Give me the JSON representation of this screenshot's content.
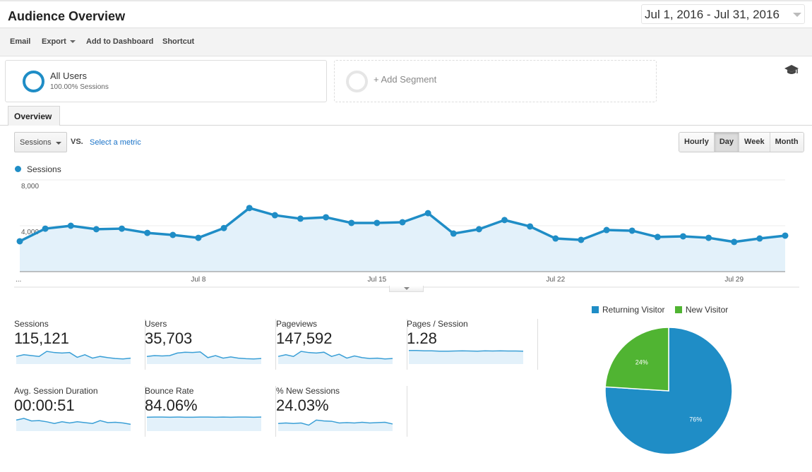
{
  "header": {
    "title": "Audience Overview",
    "date_range": "Jul 1, 2016 - Jul 31, 2016"
  },
  "toolbar": {
    "items": [
      "Email",
      "Export",
      "Add to Dashboard",
      "Shortcut"
    ],
    "help_icon": "graduation-cap-icon"
  },
  "segments": {
    "active": {
      "name": "All Users",
      "sub": "100.00% Sessions",
      "color": "#1f8dc6"
    },
    "add_label": "+ Add Segment"
  },
  "tabs": {
    "overview": "Overview"
  },
  "controls": {
    "metric_select": "Sessions",
    "vs_label": "VS.",
    "select_metric_link": "Select a metric",
    "granularity": [
      "Hourly",
      "Day",
      "Week",
      "Month"
    ],
    "granularity_selected": "Day"
  },
  "chart_data": [
    {
      "type": "area",
      "title": "",
      "legend": [
        "Sessions"
      ],
      "legend_position": "top-left",
      "color": "#1f8dc6",
      "fill": "#e3f1fa",
      "xlabel": "",
      "ylabel": "",
      "ylim": [
        0,
        8000
      ],
      "yticks": [
        4000,
        8000
      ],
      "ytick_labels": [
        "4,000",
        "8,000"
      ],
      "x": [
        "Jul 1",
        "Jul 2",
        "Jul 3",
        "Jul 4",
        "Jul 5",
        "Jul 6",
        "Jul 7",
        "Jul 8",
        "Jul 9",
        "Jul 10",
        "Jul 11",
        "Jul 12",
        "Jul 13",
        "Jul 14",
        "Jul 15",
        "Jul 16",
        "Jul 17",
        "Jul 18",
        "Jul 19",
        "Jul 20",
        "Jul 21",
        "Jul 22",
        "Jul 23",
        "Jul 24",
        "Jul 25",
        "Jul 26",
        "Jul 27",
        "Jul 28",
        "Jul 29",
        "Jul 30",
        "Jul 31"
      ],
      "xtick_labels": [
        {
          "index": 0,
          "label": "..."
        },
        {
          "index": 7,
          "label": "Jul 8"
        },
        {
          "index": 14,
          "label": "Jul 15"
        },
        {
          "index": 21,
          "label": "Jul 22"
        },
        {
          "index": 28,
          "label": "Jul 29"
        }
      ],
      "series": [
        {
          "name": "Sessions",
          "values": [
            2650,
            3750,
            4000,
            3700,
            3750,
            3380,
            3200,
            2950,
            3800,
            5550,
            4920,
            4620,
            4740,
            4250,
            4250,
            4310,
            5100,
            3320,
            3700,
            4500,
            3940,
            2890,
            2770,
            3630,
            3570,
            3020,
            3080,
            2950,
            2590,
            2890,
            3140
          ]
        }
      ],
      "grid": true
    },
    {
      "type": "pie",
      "title": "",
      "legend": [
        "Returning Visitor",
        "New Visitor"
      ],
      "legend_position": "top",
      "slices": [
        {
          "label": "Returning Visitor",
          "value": 76,
          "display": "76%",
          "color": "#1f8dc6"
        },
        {
          "label": "New Visitor",
          "value": 24,
          "display": "24%",
          "color": "#50b432"
        }
      ]
    }
  ],
  "metrics": [
    {
      "label": "Sessions",
      "value": "115,121",
      "spark": [
        0.45,
        0.55,
        0.5,
        0.45,
        0.75,
        0.68,
        0.65,
        0.68,
        0.4,
        0.55,
        0.35,
        0.45,
        0.38,
        0.33,
        0.3,
        0.35
      ]
    },
    {
      "label": "Users",
      "value": "35,703",
      "spark": [
        0.45,
        0.5,
        0.48,
        0.5,
        0.65,
        0.7,
        0.68,
        0.72,
        0.38,
        0.5,
        0.35,
        0.42,
        0.35,
        0.32,
        0.3,
        0.33
      ]
    },
    {
      "label": "Pageviews",
      "value": "147,592",
      "spark": [
        0.45,
        0.55,
        0.45,
        0.75,
        0.68,
        0.65,
        0.7,
        0.45,
        0.58,
        0.35,
        0.48,
        0.38,
        0.33,
        0.35,
        0.3,
        0.33
      ]
    },
    {
      "label": "Pages / Session",
      "value": "1.28",
      "spark": [
        0.8,
        0.8,
        0.78,
        0.78,
        0.76,
        0.76,
        0.77,
        0.78,
        0.77,
        0.76,
        0.78,
        0.77,
        0.78,
        0.77,
        0.77,
        0.76
      ]
    },
    {
      "label": "Avg. Session Duration",
      "value": "00:00:51",
      "spark": [
        0.65,
        0.75,
        0.6,
        0.62,
        0.55,
        0.45,
        0.55,
        0.48,
        0.55,
        0.5,
        0.45,
        0.62,
        0.5,
        0.52,
        0.48,
        0.4
      ]
    },
    {
      "label": "Bounce Rate",
      "value": "84.06%",
      "spark": [
        0.82,
        0.83,
        0.83,
        0.82,
        0.83,
        0.82,
        0.82,
        0.83,
        0.83,
        0.82,
        0.83,
        0.82,
        0.83,
        0.83,
        0.82,
        0.83
      ]
    },
    {
      "label": "% New Sessions",
      "value": "24.03%",
      "spark": [
        0.45,
        0.48,
        0.45,
        0.48,
        0.35,
        0.65,
        0.6,
        0.58,
        0.48,
        0.5,
        0.48,
        0.52,
        0.48,
        0.5,
        0.52,
        0.42
      ]
    }
  ]
}
